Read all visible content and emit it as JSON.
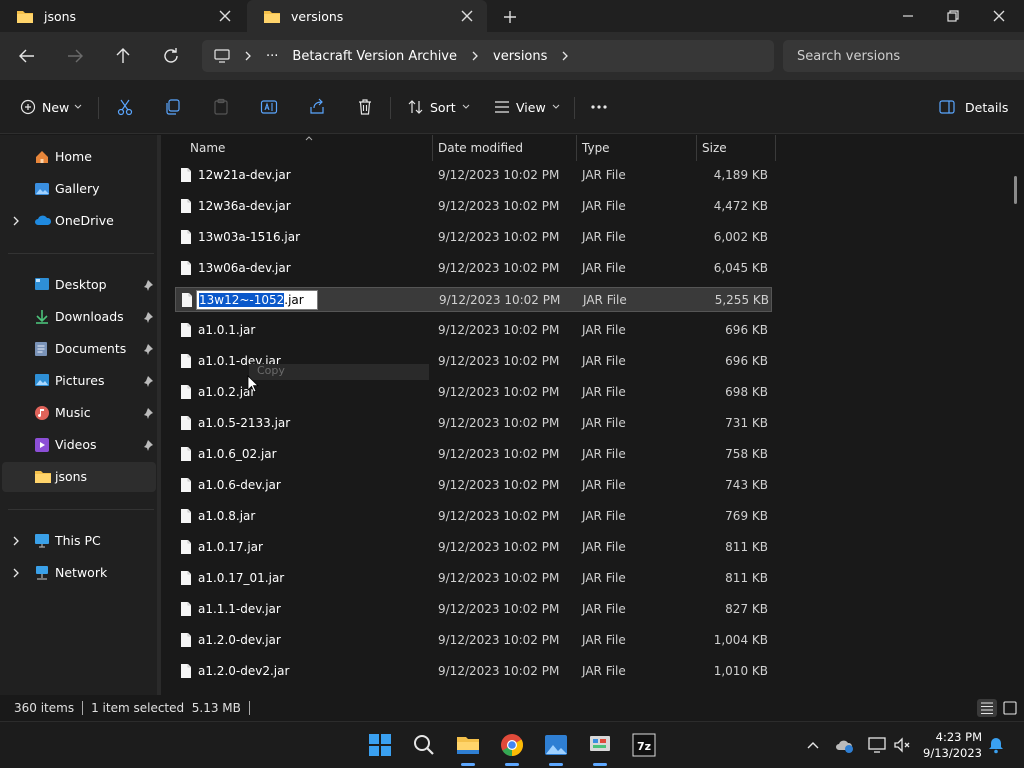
{
  "tabs": [
    {
      "label": "jsons",
      "active": false
    },
    {
      "label": "versions",
      "active": true
    }
  ],
  "address": {
    "breadcrumbs": [
      "Betacraft Version Archive",
      "versions"
    ]
  },
  "search": {
    "placeholder": "Search versions"
  },
  "toolbar": {
    "new_label": "New",
    "sort_label": "Sort",
    "view_label": "View",
    "details_label": "Details"
  },
  "nav": {
    "items": [
      {
        "label": "Home",
        "icon": "home-icon"
      },
      {
        "label": "Gallery",
        "icon": "gallery-icon"
      },
      {
        "label": "OneDrive",
        "icon": "onedrive-icon"
      },
      {
        "label": "Desktop",
        "icon": "desktop-icon"
      },
      {
        "label": "Downloads",
        "icon": "downloads-icon"
      },
      {
        "label": "Documents",
        "icon": "documents-icon"
      },
      {
        "label": "Pictures",
        "icon": "pictures-icon"
      },
      {
        "label": "Music",
        "icon": "music-icon"
      },
      {
        "label": "Videos",
        "icon": "videos-icon"
      },
      {
        "label": "jsons",
        "icon": "folder-icon"
      },
      {
        "label": "This PC",
        "icon": "this-pc-icon"
      },
      {
        "label": "Network",
        "icon": "network-icon"
      }
    ]
  },
  "columns": {
    "name": "Name",
    "date": "Date modified",
    "type": "Type",
    "size": "Size"
  },
  "files": [
    {
      "name": "12w21a-dev.jar",
      "date": "9/12/2023 10:02 PM",
      "type": "JAR File",
      "size": "4,189 KB"
    },
    {
      "name": "12w36a-dev.jar",
      "date": "9/12/2023 10:02 PM",
      "type": "JAR File",
      "size": "4,472 KB"
    },
    {
      "name": "13w03a-1516.jar",
      "date": "9/12/2023 10:02 PM",
      "type": "JAR File",
      "size": "6,002 KB"
    },
    {
      "name": "13w06a-dev.jar",
      "date": "9/12/2023 10:02 PM",
      "type": "JAR File",
      "size": "6,045 KB"
    },
    {
      "name": "13w12~-1052.jar",
      "date": "9/12/2023 10:02 PM",
      "type": "JAR File",
      "size": "5,255 KB"
    },
    {
      "name": "a1.0.1.jar",
      "date": "9/12/2023 10:02 PM",
      "type": "JAR File",
      "size": "696 KB"
    },
    {
      "name": "a1.0.1-dev.jar",
      "date": "9/12/2023 10:02 PM",
      "type": "JAR File",
      "size": "696 KB"
    },
    {
      "name": "a1.0.2.jar",
      "date": "9/12/2023 10:02 PM",
      "type": "JAR File",
      "size": "698 KB"
    },
    {
      "name": "a1.0.5-2133.jar",
      "date": "9/12/2023 10:02 PM",
      "type": "JAR File",
      "size": "731 KB"
    },
    {
      "name": "a1.0.6_02.jar",
      "date": "9/12/2023 10:02 PM",
      "type": "JAR File",
      "size": "758 KB"
    },
    {
      "name": "a1.0.6-dev.jar",
      "date": "9/12/2023 10:02 PM",
      "type": "JAR File",
      "size": "743 KB"
    },
    {
      "name": "a1.0.8.jar",
      "date": "9/12/2023 10:02 PM",
      "type": "JAR File",
      "size": "769 KB"
    },
    {
      "name": "a1.0.17.jar",
      "date": "9/12/2023 10:02 PM",
      "type": "JAR File",
      "size": "811 KB"
    },
    {
      "name": "a1.0.17_01.jar",
      "date": "9/12/2023 10:02 PM",
      "type": "JAR File",
      "size": "811 KB"
    },
    {
      "name": "a1.1.1-dev.jar",
      "date": "9/12/2023 10:02 PM",
      "type": "JAR File",
      "size": "827 KB"
    },
    {
      "name": "a1.2.0-dev.jar",
      "date": "9/12/2023 10:02 PM",
      "type": "JAR File",
      "size": "1,004 KB"
    },
    {
      "name": "a1.2.0-dev2.jar",
      "date": "9/12/2023 10:02 PM",
      "type": "JAR File",
      "size": "1,010 KB"
    }
  ],
  "rename": {
    "selected_part": "13w12~-1052",
    "extension": ".jar"
  },
  "tooltip": {
    "text": "Copy"
  },
  "status": {
    "items": "360 items",
    "selection": "1 item selected  5.13 MB"
  },
  "clock": {
    "time": "4:23 PM",
    "date": "9/13/2023"
  },
  "colors": {
    "accent": "#0a58ca",
    "folder": "#f4c04a"
  }
}
